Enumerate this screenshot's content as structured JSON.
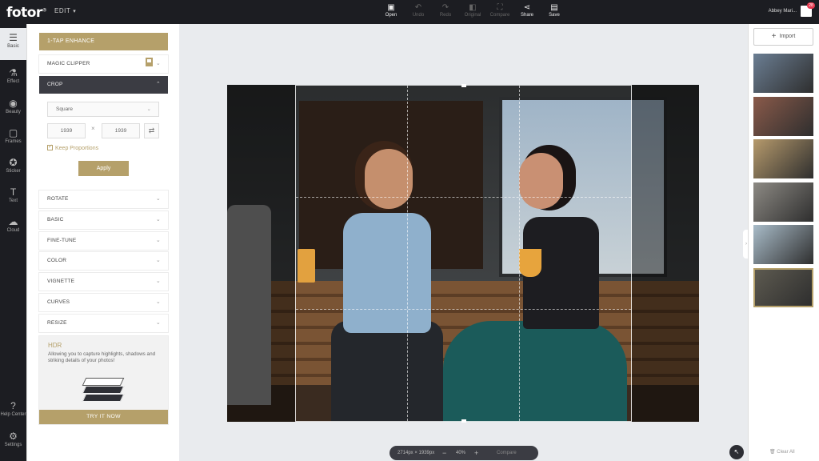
{
  "app": {
    "logo": "fotor",
    "logo_mark": "®",
    "menu": "EDIT"
  },
  "toolbar": [
    {
      "label": "Open",
      "icon": "folder-icon",
      "glyph": "▣",
      "enabled": true
    },
    {
      "label": "Undo",
      "icon": "undo-icon",
      "glyph": "↶",
      "enabled": false
    },
    {
      "label": "Redo",
      "icon": "redo-icon",
      "glyph": "↷",
      "enabled": false
    },
    {
      "label": "Original",
      "icon": "original-icon",
      "glyph": "◧",
      "enabled": false
    },
    {
      "label": "Compare",
      "icon": "compare-icon",
      "glyph": "⛶",
      "enabled": false
    },
    {
      "label": "Share",
      "icon": "share-icon",
      "glyph": "⋖",
      "enabled": true
    },
    {
      "label": "Save",
      "icon": "save-icon",
      "glyph": "▤",
      "enabled": true
    }
  ],
  "user": {
    "name": "Abbey Mari...",
    "notifications": "28"
  },
  "rail": [
    {
      "label": "Basic",
      "icon": "sliders-icon",
      "glyph": "☰",
      "active": true
    },
    {
      "label": "Effect",
      "icon": "flask-icon",
      "glyph": "⚗",
      "active": false
    },
    {
      "label": "Beauty",
      "icon": "eye-icon",
      "glyph": "◉",
      "active": false
    },
    {
      "label": "Frames",
      "icon": "frame-icon",
      "glyph": "▢",
      "active": false
    },
    {
      "label": "Sticker",
      "icon": "sticker-icon",
      "glyph": "✪",
      "active": false
    },
    {
      "label": "Text",
      "icon": "text-icon",
      "glyph": "T",
      "active": false
    },
    {
      "label": "Cloud",
      "icon": "cloud-icon",
      "glyph": "☁",
      "active": false
    },
    {
      "label": "Help Center",
      "icon": "help-icon",
      "glyph": "?",
      "active": false
    },
    {
      "label": "Settings",
      "icon": "settings-icon",
      "glyph": "⚙",
      "active": false
    }
  ],
  "panel": {
    "enhance": "1-TAP ENHANCE",
    "magic_clipper": "MAGIC CLIPPER",
    "crop": "CROP",
    "crop_ratio": "Square",
    "width": "1939",
    "height": "1939",
    "times": "×",
    "swap_glyph": "⇄",
    "keep_proportions": "Keep Proportions",
    "apply": "Apply",
    "sections": [
      "ROTATE",
      "BASIC",
      "FINE-TUNE",
      "COLOR",
      "VIGNETTE",
      "CURVES",
      "RESIZE"
    ],
    "hdr_title": "HDR",
    "hdr_text": "Allowing you to capture highlights, shadows and striking details of your photos!",
    "try_it": "TRY IT NOW"
  },
  "status": {
    "size": "2714px × 1939px",
    "minus": "−",
    "zoom": "40%",
    "plus": "+",
    "compare": "Compare"
  },
  "right": {
    "import": "Import",
    "clear_all": "Clear All",
    "thumbs": [
      {
        "bg": "#6b7e93",
        "selected": false
      },
      {
        "bg": "#8a5a4a",
        "selected": false
      },
      {
        "bg": "#b69a6c",
        "selected": false
      },
      {
        "bg": "#8d8a84",
        "selected": false
      },
      {
        "bg": "#a9bcc9",
        "selected": false
      },
      {
        "bg": "#5d5a50",
        "selected": true
      }
    ]
  },
  "colors": {
    "accent": "#b5a06a",
    "dark": "#1c1d22"
  }
}
